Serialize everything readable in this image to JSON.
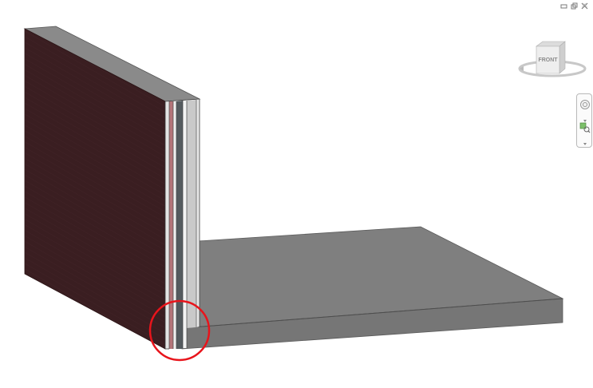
{
  "window_controls": {
    "minimize_icon": "minimize-icon",
    "restore_icon": "restore-icon",
    "close_icon": "close-icon"
  },
  "viewcube": {
    "face_label": "FRONT"
  },
  "navigation_bar": {
    "items": [
      "steering-wheel-icon",
      "zoom-region-icon"
    ]
  },
  "colors": {
    "wall_face": "#3b1f22",
    "wall_edge": "#5a5a5a",
    "floor_top": "#7f7f7f",
    "floor_side": "#767676",
    "highlight_circle": "#e8141b",
    "layer_pink": "#b5757a"
  }
}
